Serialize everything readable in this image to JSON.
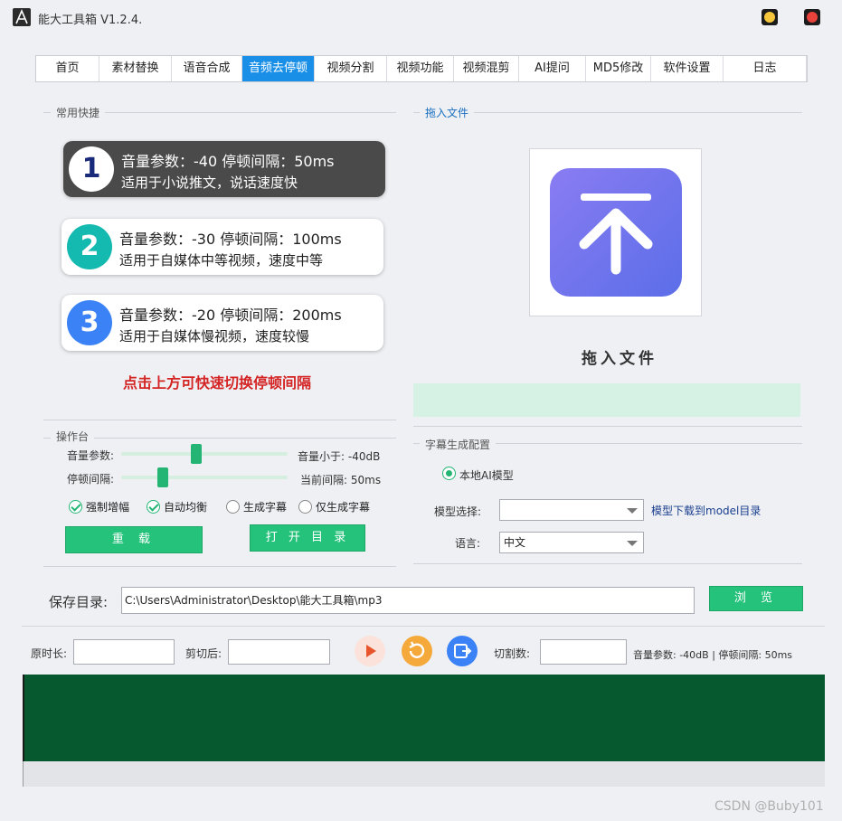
{
  "window": {
    "title": "能大工具箱 V1.2.4.",
    "min_color": "#f6c63b",
    "close_color": "#e8423b"
  },
  "tabs": [
    {
      "label": "首页",
      "active": false
    },
    {
      "label": "素材替换",
      "active": false
    },
    {
      "label": "语音合成",
      "active": false
    },
    {
      "label": "音频去停顿",
      "active": true
    },
    {
      "label": "视频分割",
      "active": false
    },
    {
      "label": "视频功能",
      "active": false
    },
    {
      "label": "视频混剪",
      "active": false
    },
    {
      "label": "AI提问",
      "active": false
    },
    {
      "label": "MD5修改",
      "active": false
    },
    {
      "label": "软件设置",
      "active": false
    },
    {
      "label": "日志",
      "active": false
    }
  ],
  "quick": {
    "title": "常用快捷",
    "presets": [
      {
        "num": "1",
        "line1": "音量参数：-40  停顿间隔：50ms",
        "line2": "适用于小说推文，说话速度快",
        "color": "#1a2a7a",
        "selected": true
      },
      {
        "num": "2",
        "line1": "音量参数：-30  停顿间隔：100ms",
        "line2": "适用于自媒体中等视频，速度中等",
        "color": "#14b9b0",
        "selected": false
      },
      {
        "num": "3",
        "line1": "音量参数：-20  停顿间隔：200ms",
        "line2": "适用于自媒体慢视频，速度较慢",
        "color": "#3b82f6",
        "selected": false
      }
    ],
    "hint": "点击上方可快速切换停顿间隔"
  },
  "drop": {
    "title": "拖入文件",
    "label": "拖入文件",
    "icon": "upload-icon"
  },
  "console": {
    "title": "操作台",
    "volume_label": "音量参数:",
    "volume_value": "音量小于: -40dB",
    "volume_level": 0.45,
    "pause_label": "停顿间隔:",
    "pause_value": "当前间隔: 50ms",
    "pause_level": 0.25,
    "checks": [
      {
        "label": "强制增幅",
        "checked": true
      },
      {
        "label": "自动均衡",
        "checked": true
      },
      {
        "label": "生成字幕",
        "checked": false
      },
      {
        "label": "仅生成字幕",
        "checked": false
      }
    ],
    "reload_label": "重 载",
    "open_dir_label": "打 开 目 录"
  },
  "subtitle": {
    "title": "字幕生成配置",
    "local_model_label": "本地AI模型",
    "model_select_label": "模型选择:",
    "model_value": "",
    "model_link": "模型下载到model目录",
    "lang_label": "语言:",
    "lang_value": "中文"
  },
  "save": {
    "label": "保存目录:",
    "path": "C:\\Users\\Administrator\\Desktop\\能大工具箱\\mp3",
    "browse_label": "浏 览"
  },
  "bottom": {
    "orig_len_label": "原时长:",
    "orig_len_value": "",
    "after_cut_label": "剪切后:",
    "after_cut_value": "",
    "cut_count_label": "切割数:",
    "cut_count_value": "",
    "status": "音量参数: -40dB | 停顿间隔: 50ms",
    "play_color": "#e8552c",
    "refresh_color": "#f4a93a",
    "export_color": "#3b82f6",
    "wave_color": "#06582f"
  },
  "watermark": "CSDN @Buby101"
}
